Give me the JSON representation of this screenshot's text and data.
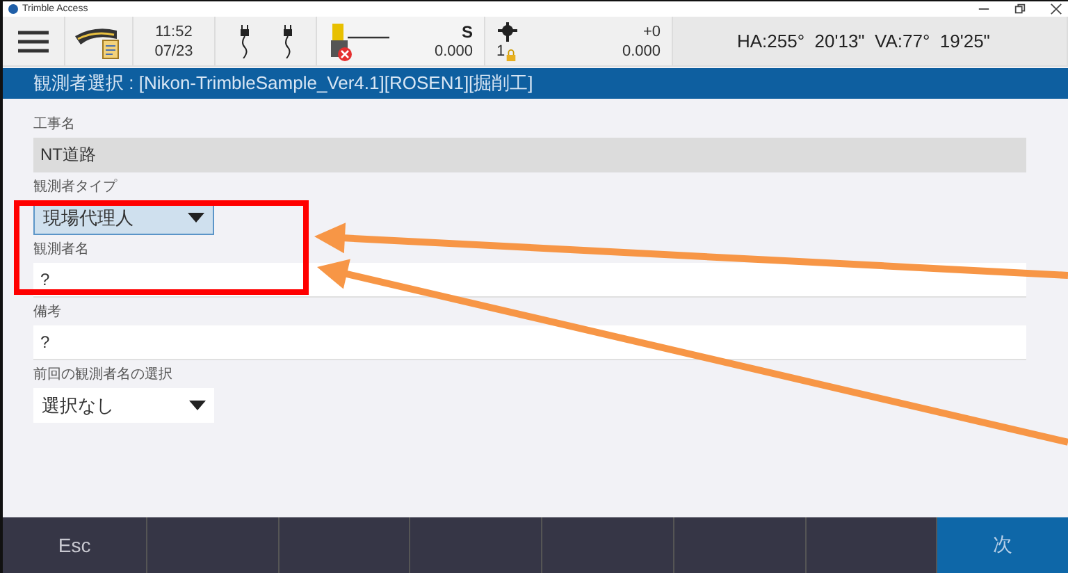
{
  "window": {
    "title": "Trimble Access"
  },
  "toolbar": {
    "time": "11:52",
    "date": "07/23",
    "instrument": {
      "mode": "S",
      "value": "0.000"
    },
    "target": {
      "number": "1",
      "offset": "+0",
      "value": "0.000"
    },
    "angles": "HA:255°  20'13\"  VA:77°  19'25\""
  },
  "header": "観測者選択 : [Nikon-TrimbleSample_Ver4.1][ROSEN1][掘削工]",
  "fields": [
    {
      "kind": "readonly",
      "label": "工事名",
      "value": "NT道路"
    },
    {
      "kind": "dropdown",
      "label": "観測者タイプ",
      "value": "現場代理人",
      "focused": true
    },
    {
      "kind": "text",
      "label": "観測者名",
      "value": "?"
    },
    {
      "kind": "text",
      "label": "備考",
      "value": "?"
    },
    {
      "kind": "dropdown",
      "label": "前回の観測者名の選択",
      "value": "選択なし",
      "focused": false
    }
  ],
  "softkeys": [
    {
      "kind": "key",
      "label": "Esc"
    },
    {
      "kind": "blank"
    },
    {
      "kind": "blank"
    },
    {
      "kind": "blank"
    },
    {
      "kind": "blank"
    },
    {
      "kind": "blank"
    },
    {
      "kind": "blank"
    },
    {
      "kind": "primary",
      "label": "次"
    }
  ],
  "annotations": [
    {
      "kind": "box"
    },
    {
      "kind": "arrow"
    },
    {
      "kind": "arrow"
    }
  ]
}
